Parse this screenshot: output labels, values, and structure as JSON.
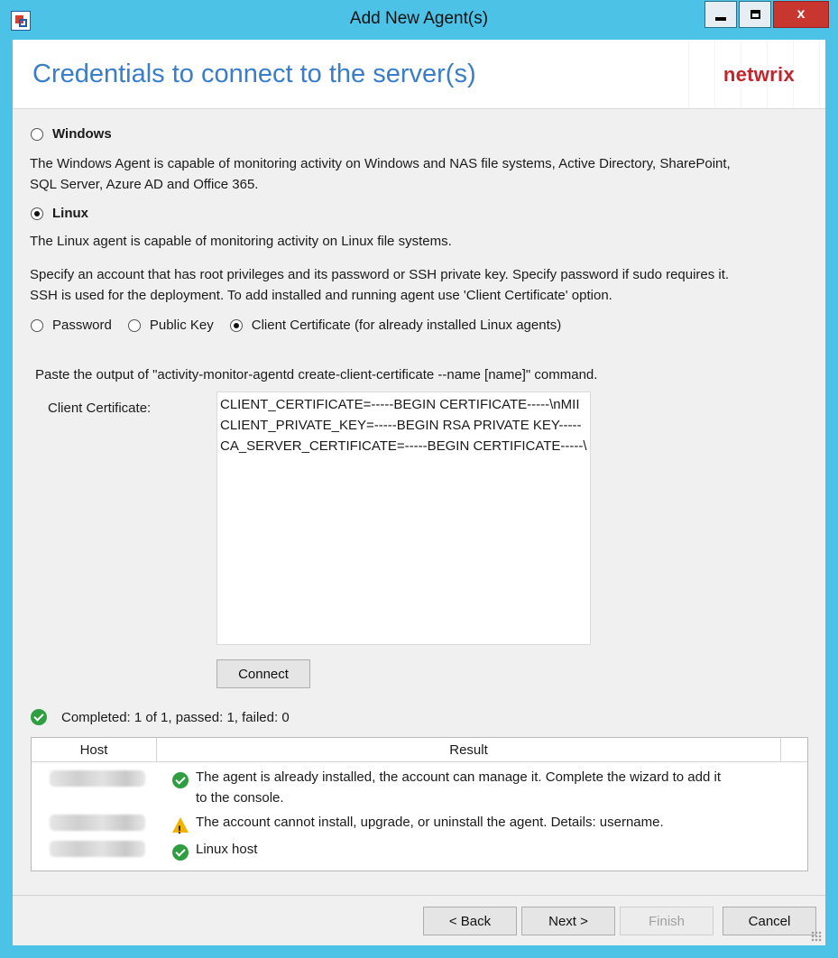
{
  "window": {
    "title": "Add New Agent(s)",
    "controls": {
      "minimize": "minimize",
      "maximize": "maximize",
      "close": "x"
    }
  },
  "header": {
    "title": "Credentials to connect to the server(s)",
    "logo": "netwrix"
  },
  "agent_type": {
    "windows": {
      "label": "Windows",
      "selected": false,
      "description_line1": "The Windows Agent is capable of monitoring activity on Windows and NAS file systems, Active Directory, SharePoint,",
      "description_line2": "SQL Server, Azure AD and Office 365."
    },
    "linux": {
      "label": "Linux",
      "selected": true,
      "description": "The Linux agent is capable of monitoring activity on Linux file systems."
    }
  },
  "instructions": {
    "line1": "Specify an account that has root privileges and its password or SSH private key. Specify password if sudo requires it.",
    "line2": "SSH is used for the deployment. To add installed and running agent use 'Client Certificate' option."
  },
  "auth_method": {
    "options": [
      {
        "label": "Password",
        "selected": false
      },
      {
        "label": "Public Key",
        "selected": false
      },
      {
        "label": "Client Certificate (for already installed Linux agents)",
        "selected": true
      }
    ]
  },
  "certificate": {
    "hint": "Paste the output of \"activity-monitor-agentd create-client-certificate --name [name]\" command.",
    "label": "Client Certificate:",
    "lines": [
      "CLIENT_CERTIFICATE=-----BEGIN CERTIFICATE-----\\nMII",
      "CLIENT_PRIVATE_KEY=-----BEGIN RSA PRIVATE KEY-----",
      "CA_SERVER_CERTIFICATE=-----BEGIN CERTIFICATE-----\\"
    ]
  },
  "connect_button": "Connect",
  "status": {
    "text": "Completed: 1 of 1, passed: 1, failed: 0",
    "icon": "check-circle-icon"
  },
  "results": {
    "columns": [
      "Host",
      "Result"
    ],
    "rows": [
      {
        "status": "ok",
        "line1": "The agent is already installed, the account can manage it. Complete the wizard to add it",
        "line2": "to the console."
      },
      {
        "status": "warning",
        "line1": "The account cannot install, upgrade, or uninstall the agent. Details: username.",
        "line2": ""
      },
      {
        "status": "ok",
        "line1": "Linux host",
        "line2": ""
      }
    ]
  },
  "footer": {
    "back": "< Back",
    "next": "Next >",
    "finish": "Finish",
    "cancel": "Cancel"
  },
  "colors": {
    "window_frame": "#4cc3e6",
    "header_title": "#3a7dc9",
    "logo": "#c4252b",
    "ok": "#2f9e41",
    "warning": "#f0b400"
  }
}
